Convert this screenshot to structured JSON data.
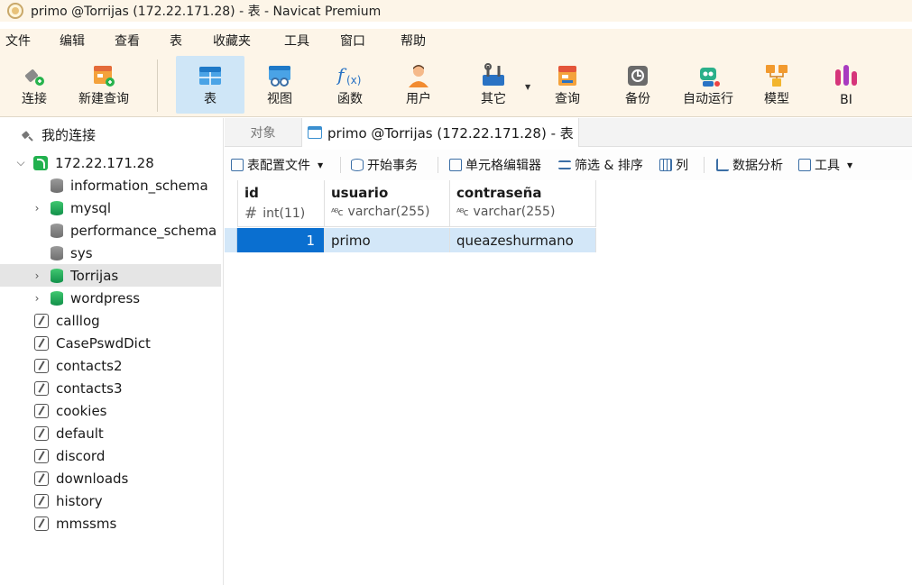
{
  "window": {
    "title": "primo @Torrijas (172.22.171.28) - 表 - Navicat Premium"
  },
  "menu": [
    "文件",
    "编辑",
    "查看",
    "表",
    "收藏夹",
    "工具",
    "窗口",
    "帮助"
  ],
  "toolbar": {
    "connect": "连接",
    "new_query": "新建查询",
    "table": "表",
    "view": "视图",
    "function": "函数",
    "user": "用户",
    "other": "其它",
    "query": "查询",
    "backup": "备份",
    "automation": "自动运行",
    "model": "模型",
    "bi": "BI"
  },
  "sidebar": {
    "my_connections": "我的连接",
    "connection": "172.22.171.28",
    "databases": [
      "information_schema",
      "mysql",
      "performance_schema",
      "sys",
      "Torrijas",
      "wordpress"
    ],
    "sqlite_items": [
      "calllog",
      "CasePswdDict",
      "contacts2",
      "contacts3",
      "cookies",
      "default",
      "discord",
      "downloads",
      "history",
      "mmssms"
    ]
  },
  "tabs": {
    "objects": "对象",
    "active": "primo @Torrijas (172.22.171.28) - 表"
  },
  "subtoolbar": {
    "table_profile": "表配置文件",
    "begin_transaction": "开始事务",
    "cell_editor": "单元格编辑器",
    "filter_sort": "筛选 & 排序",
    "columns": "列",
    "data_analysis": "数据分析",
    "tools": "工具"
  },
  "grid": {
    "columns": [
      {
        "name": "id",
        "type": "int(11)"
      },
      {
        "name": "usuario",
        "type": "varchar(255)"
      },
      {
        "name": "contraseña",
        "type": "varchar(255)"
      }
    ],
    "rows": [
      {
        "id": "1",
        "usuario": "primo",
        "contrasena": "queazeshurmano"
      }
    ]
  }
}
